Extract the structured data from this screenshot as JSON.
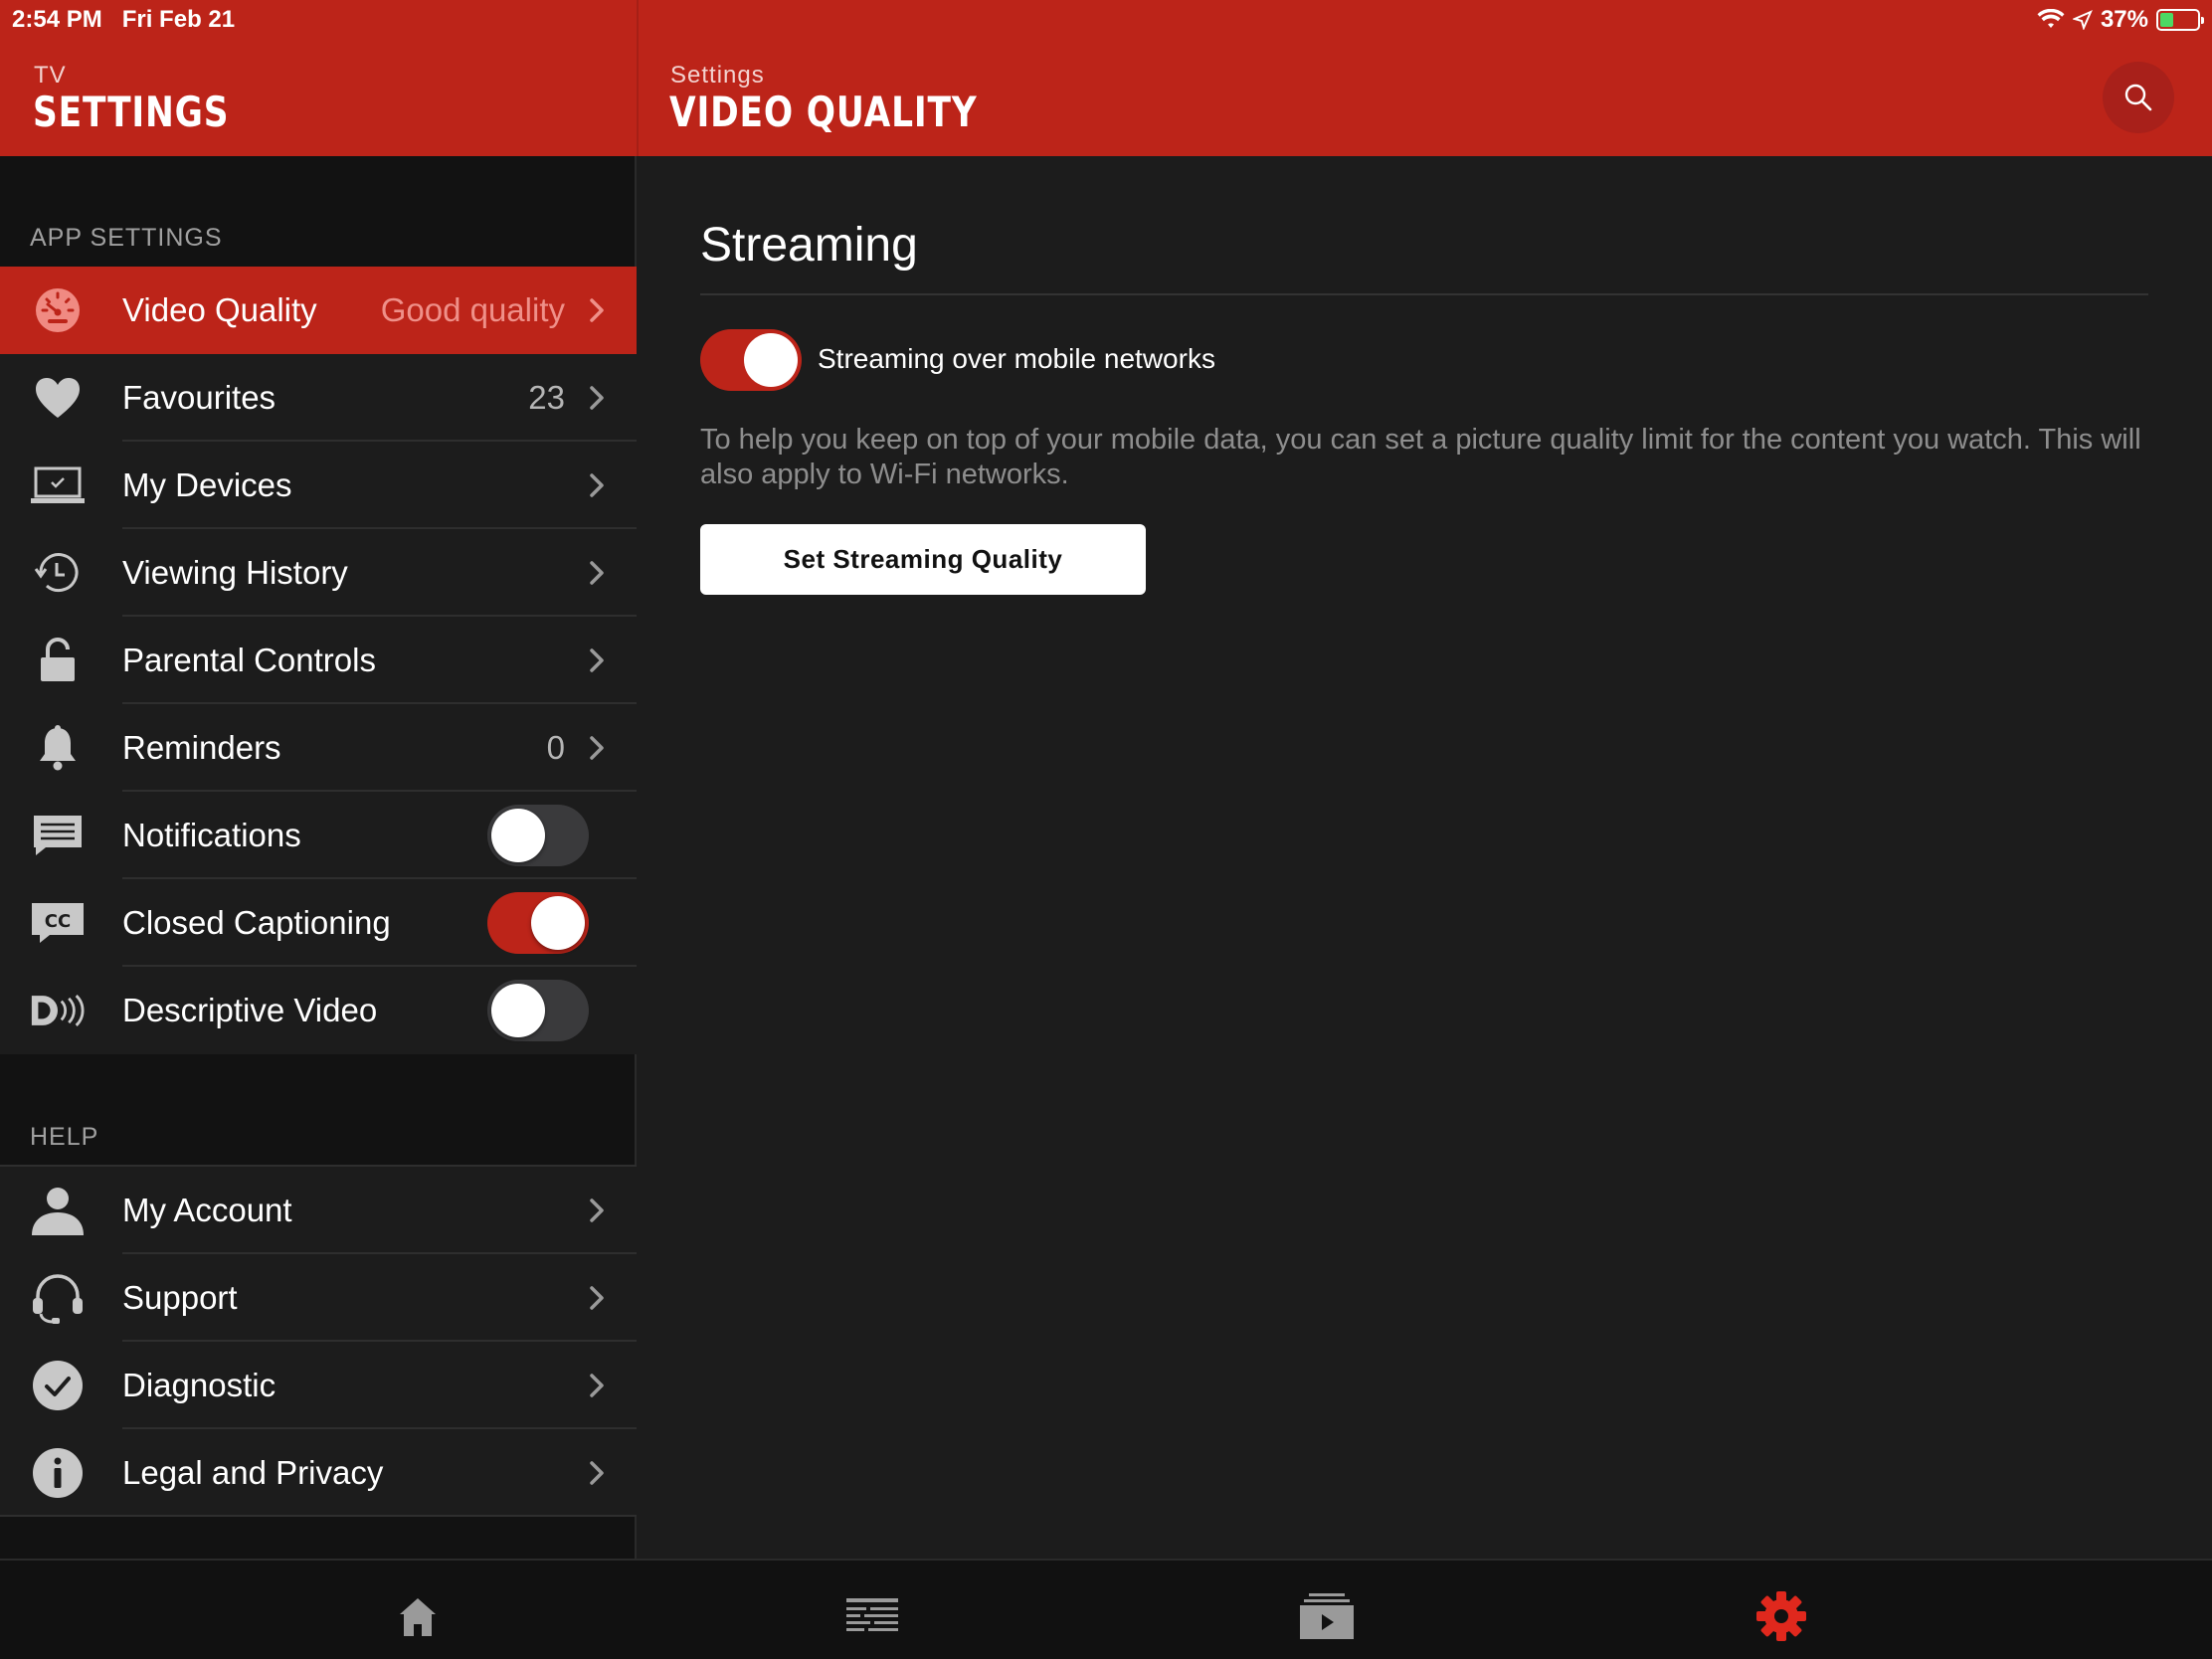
{
  "status_bar": {
    "time": "2:54 PM",
    "date": "Fri Feb 21",
    "battery": "37%",
    "icons": [
      "wifi-icon",
      "location-icon",
      "battery-charging-icon"
    ]
  },
  "header_left": {
    "subtitle": "TV",
    "title": "SETTINGS"
  },
  "header_right": {
    "subtitle": "Settings",
    "title": "VIDEO QUALITY",
    "search_icon": "search-icon"
  },
  "sidebar": {
    "app_settings_label": "APP SETTINGS",
    "help_label": "HELP",
    "app_items": [
      {
        "label": "Video Quality",
        "value": "Good quality",
        "icon": "speedometer-icon",
        "selected": true
      },
      {
        "label": "Favourites",
        "value": "23",
        "icon": "heart-icon"
      },
      {
        "label": "My Devices",
        "value": "",
        "icon": "laptop-icon"
      },
      {
        "label": "Viewing History",
        "value": "",
        "icon": "history-icon"
      },
      {
        "label": "Parental Controls",
        "value": "",
        "icon": "lock-icon"
      },
      {
        "label": "Reminders",
        "value": "0",
        "icon": "bell-icon"
      },
      {
        "label": "Notifications",
        "toggle": false,
        "icon": "message-icon"
      },
      {
        "label": "Closed Captioning",
        "toggle": true,
        "icon": "cc-icon"
      },
      {
        "label": "Descriptive Video",
        "toggle": false,
        "icon": "descriptive-video-icon"
      }
    ],
    "help_items": [
      {
        "label": "My Account",
        "icon": "person-icon"
      },
      {
        "label": "Support",
        "icon": "headset-icon"
      },
      {
        "label": "Diagnostic",
        "icon": "check-circle-icon"
      },
      {
        "label": "Legal and Privacy",
        "icon": "info-icon"
      }
    ]
  },
  "content": {
    "section_title": "Streaming",
    "toggle_label": "Streaming over mobile networks",
    "toggle_on": true,
    "description": "To help you keep on top of your mobile data, you can set a picture quality limit for the content you watch. This will also apply to Wi-Fi networks.",
    "button_label": "Set Streaming Quality"
  },
  "tab_bar": {
    "tabs": [
      "home-icon",
      "guide-icon",
      "library-icon",
      "settings-gear-icon"
    ],
    "active": "settings-gear-icon"
  },
  "colors": {
    "accent": "#bc2419",
    "background": "#1c1c1c",
    "sidebar_background": "#121212"
  }
}
